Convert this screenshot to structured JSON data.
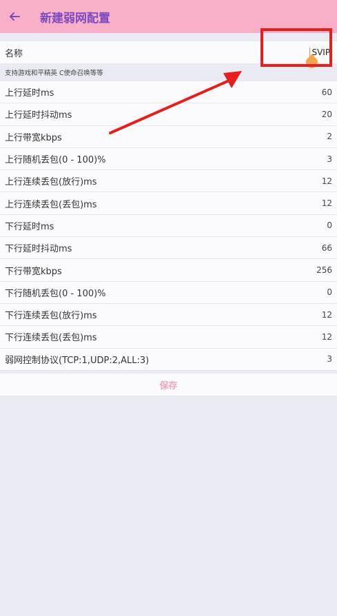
{
  "appbar": {
    "title": "新建弱网配置",
    "back_icon": "arrow-left-icon",
    "accent": "#7B4BC0",
    "background": "#F9AFC7"
  },
  "name_field": {
    "label": "名称",
    "value": "SVIP."
  },
  "hint": "支持游戏和平精英 C使命召唤等等",
  "rows": [
    {
      "label": "上行延时ms",
      "value": "60"
    },
    {
      "label": "上行延时抖动ms",
      "value": "20"
    },
    {
      "label": "上行带宽kbps",
      "value": "2"
    },
    {
      "label": "上行随机丢包(0 - 100)%",
      "value": "3"
    },
    {
      "label": "上行连续丢包(放行)ms",
      "value": "12"
    },
    {
      "label": "上行连续丢包(丢包)ms",
      "value": "12"
    },
    {
      "label": "下行延时ms",
      "value": "0"
    },
    {
      "label": "下行延时抖动ms",
      "value": "66"
    },
    {
      "label": "下行带宽kbps",
      "value": "256"
    },
    {
      "label": "下行随机丢包(0 - 100)%",
      "value": "0"
    },
    {
      "label": "下行连续丢包(放行)ms",
      "value": "12"
    },
    {
      "label": "下行连续丢包(丢包)ms",
      "value": "12"
    },
    {
      "label": "弱网控制协议(TCP:1,UDP:2,ALL:3)",
      "value": "3"
    }
  ],
  "save_label": "保存",
  "annotation_color": "#E61E1E"
}
